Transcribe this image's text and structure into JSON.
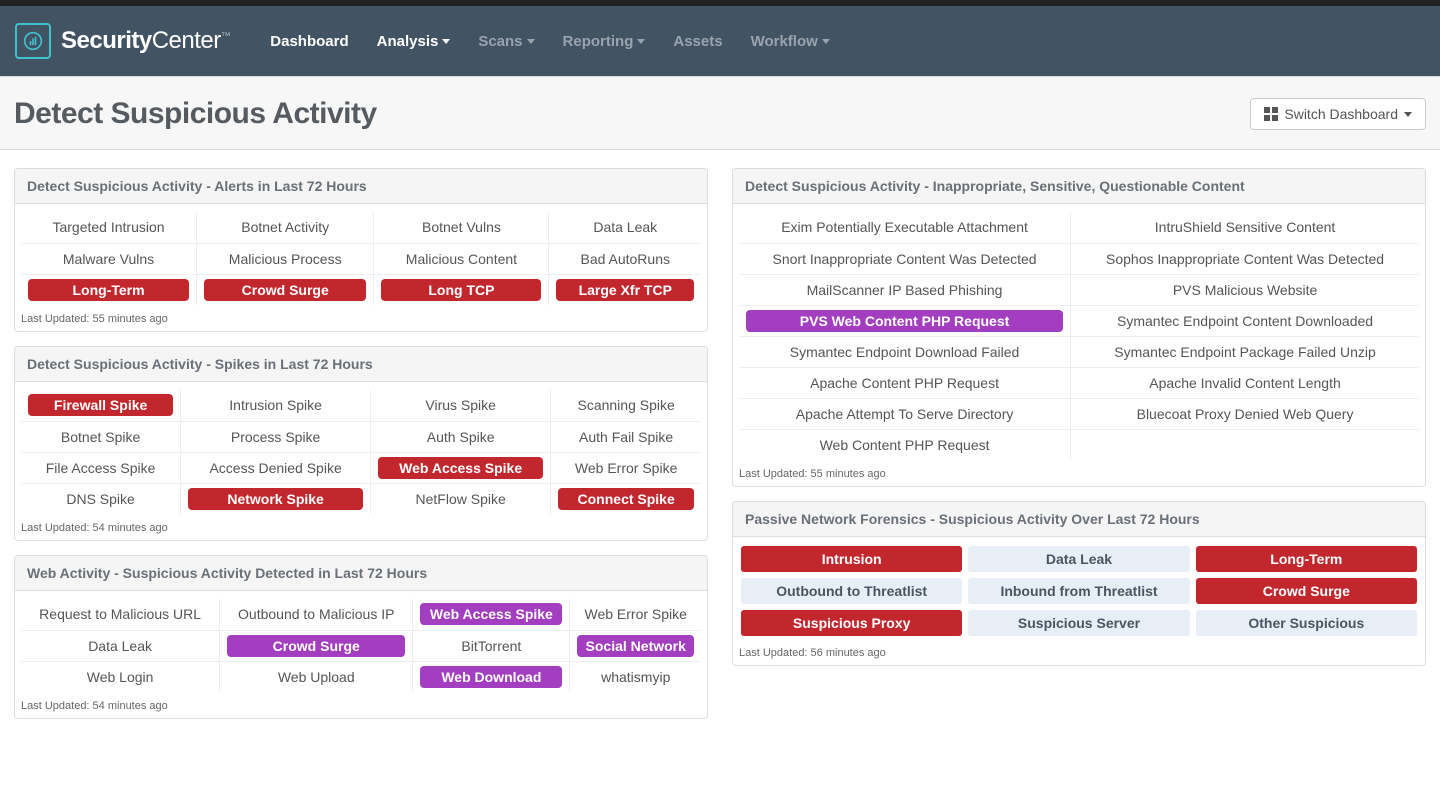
{
  "brand": "SecurityCenter",
  "nav": {
    "dashboard": "Dashboard",
    "analysis": "Analysis",
    "scans": "Scans",
    "reporting": "Reporting",
    "assets": "Assets",
    "workflow": "Workflow"
  },
  "page_title": "Detect Suspicious Activity",
  "switch_dashboard_label": "Switch Dashboard",
  "panels": {
    "alerts": {
      "title": "Detect Suspicious Activity - Alerts in Last 72 Hours",
      "rows": [
        [
          {
            "t": "Targeted Intrusion"
          },
          {
            "t": "Botnet Activity"
          },
          {
            "t": "Botnet Vulns"
          },
          {
            "t": "Data Leak"
          }
        ],
        [
          {
            "t": "Malware Vulns"
          },
          {
            "t": "Malicious Process"
          },
          {
            "t": "Malicious Content"
          },
          {
            "t": "Bad AutoRuns"
          }
        ],
        [
          {
            "t": "Long-Term",
            "c": "red"
          },
          {
            "t": "Crowd Surge",
            "c": "red"
          },
          {
            "t": "Long TCP",
            "c": "red"
          },
          {
            "t": "Large Xfr TCP",
            "c": "red"
          }
        ]
      ],
      "updated": "Last Updated: 55 minutes ago"
    },
    "spikes": {
      "title": "Detect Suspicious Activity - Spikes in Last 72 Hours",
      "rows": [
        [
          {
            "t": "Firewall Spike",
            "c": "red"
          },
          {
            "t": "Intrusion Spike"
          },
          {
            "t": "Virus Spike"
          },
          {
            "t": "Scanning Spike"
          }
        ],
        [
          {
            "t": "Botnet Spike"
          },
          {
            "t": "Process Spike"
          },
          {
            "t": "Auth Spike"
          },
          {
            "t": "Auth Fail Spike"
          }
        ],
        [
          {
            "t": "File Access Spike"
          },
          {
            "t": "Access Denied Spike"
          },
          {
            "t": "Web Access Spike",
            "c": "red"
          },
          {
            "t": "Web Error Spike"
          }
        ],
        [
          {
            "t": "DNS Spike"
          },
          {
            "t": "Network Spike",
            "c": "red"
          },
          {
            "t": "NetFlow Spike"
          },
          {
            "t": "Connect Spike",
            "c": "red"
          }
        ]
      ],
      "updated": "Last Updated: 54 minutes ago"
    },
    "web": {
      "title": "Web Activity - Suspicious Activity Detected in Last 72 Hours",
      "rows": [
        [
          {
            "t": "Request to Malicious URL"
          },
          {
            "t": "Outbound to Malicious IP"
          },
          {
            "t": "Web Access Spike",
            "c": "purple"
          },
          {
            "t": "Web Error Spike"
          }
        ],
        [
          {
            "t": "Data Leak"
          },
          {
            "t": "Crowd Surge",
            "c": "purple"
          },
          {
            "t": "BitTorrent"
          },
          {
            "t": "Social Network",
            "c": "purple"
          }
        ],
        [
          {
            "t": "Web Login"
          },
          {
            "t": "Web Upload"
          },
          {
            "t": "Web Download",
            "c": "purple"
          },
          {
            "t": "whatismyip"
          }
        ]
      ],
      "updated": "Last Updated: 54 minutes ago"
    },
    "inapp": {
      "title": "Detect Suspicious Activity - Inappropriate, Sensitive, Questionable Content",
      "rows": [
        [
          {
            "t": "Exim Potentially Executable Attachment"
          },
          {
            "t": "IntruShield Sensitive Content"
          }
        ],
        [
          {
            "t": "Snort Inappropriate Content Was Detected"
          },
          {
            "t": "Sophos Inappropriate Content Was Detected"
          }
        ],
        [
          {
            "t": "MailScanner IP Based Phishing"
          },
          {
            "t": "PVS Malicious Website"
          }
        ],
        [
          {
            "t": "PVS Web Content PHP Request",
            "c": "purple"
          },
          {
            "t": "Symantec Endpoint Content Downloaded"
          }
        ],
        [
          {
            "t": "Symantec Endpoint Download Failed"
          },
          {
            "t": "Symantec Endpoint Package Failed Unzip"
          }
        ],
        [
          {
            "t": "Apache Content PHP Request"
          },
          {
            "t": "Apache Invalid Content Length"
          }
        ],
        [
          {
            "t": "Apache Attempt To Serve Directory"
          },
          {
            "t": "Bluecoat Proxy Denied Web Query"
          }
        ],
        [
          {
            "t": "Web Content PHP Request"
          },
          {
            "t": ""
          }
        ]
      ],
      "updated": "Last Updated: 55 minutes ago"
    },
    "forensics": {
      "title": "Passive Network Forensics - Suspicious Activity Over Last 72 Hours",
      "rows": [
        [
          {
            "t": "Intrusion",
            "c": "red"
          },
          {
            "t": "Data Leak",
            "c": "blue"
          },
          {
            "t": "Long-Term",
            "c": "red"
          }
        ],
        [
          {
            "t": "Outbound to Threatlist",
            "c": "blue"
          },
          {
            "t": "Inbound from Threatlist",
            "c": "blue"
          },
          {
            "t": "Crowd Surge",
            "c": "red"
          }
        ],
        [
          {
            "t": "Suspicious Proxy",
            "c": "red"
          },
          {
            "t": "Suspicious Server",
            "c": "blue"
          },
          {
            "t": "Other Suspicious",
            "c": "blue"
          }
        ]
      ],
      "updated": "Last Updated: 56 minutes ago"
    }
  }
}
